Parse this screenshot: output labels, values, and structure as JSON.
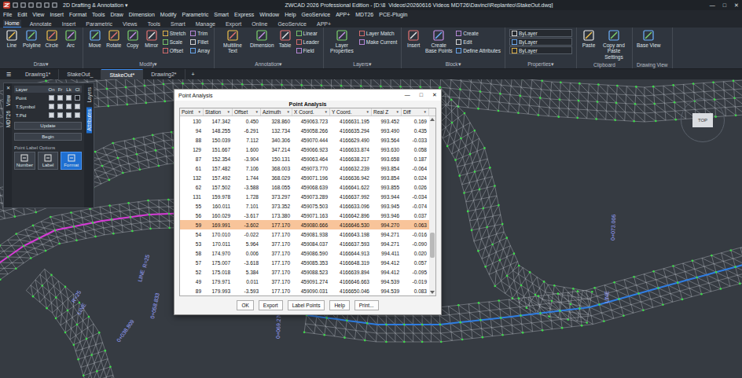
{
  "titlebar": {
    "workspace": "2D Drafting & Annotation",
    "workspace_arrow": "▾",
    "title": "ZWCAD 2026 Professional Edition - [D:\\8_Videos\\20260616 Videos MDT26\\Davinci\\Replanteo\\StakeOut.dwg]",
    "controls": [
      "—",
      "□",
      "✕"
    ]
  },
  "menu": [
    "File",
    "Edit",
    "View",
    "Insert",
    "Format",
    "Tools",
    "Draw",
    "Dimension",
    "Modify",
    "Parametric",
    "Smart",
    "Express",
    "Window",
    "Help",
    "GeoService",
    "APP+",
    "MDT26",
    "PCE-Plugin"
  ],
  "ribbon_tabs": [
    {
      "label": "Home",
      "selected": true
    },
    {
      "label": "Annotate",
      "selected": false
    },
    {
      "label": "Insert",
      "selected": false
    },
    {
      "label": "Parametric",
      "selected": false
    },
    {
      "label": "Views",
      "selected": false
    },
    {
      "label": "Tools",
      "selected": false
    },
    {
      "label": "Smart",
      "selected": false
    },
    {
      "label": "Manage",
      "selected": false
    },
    {
      "label": "Export",
      "selected": false
    },
    {
      "label": "Online",
      "selected": false
    },
    {
      "label": "GeoService",
      "selected": false
    },
    {
      "label": "APP+",
      "selected": false
    }
  ],
  "group_arrow": "▾",
  "ribbon_groups": [
    {
      "label": "Draw",
      "has_menu": true,
      "large": [
        "Line",
        "Polyline",
        "Circle",
        "Arc"
      ],
      "small": []
    },
    {
      "label": "Modify",
      "has_menu": true,
      "large": [
        "Move",
        "Rotate",
        "Copy",
        "Mirror"
      ],
      "small": [
        "Stretch",
        "Scale",
        "Offset",
        "Trim",
        "Fillet",
        "Array"
      ]
    },
    {
      "label": "Annotation",
      "has_menu": true,
      "large": [
        "Multiline Text",
        "Dimension",
        "Table"
      ],
      "small": [
        "Linear",
        "Leader",
        "Field"
      ]
    },
    {
      "label": "Layers",
      "has_menu": true,
      "large": [
        "Layer Properties"
      ],
      "small": [
        "Layer Match",
        "Make Current"
      ]
    },
    {
      "label": "Block",
      "has_menu": true,
      "large": [
        "Insert",
        "Create Base Points"
      ],
      "small": [
        "Create",
        "Edit",
        "Define Attributes"
      ]
    },
    {
      "label": "Properties",
      "has_menu": true,
      "large": [],
      "small": [
        "ByLayer",
        "ByLayer",
        "ByLayer"
      ]
    },
    {
      "label": "Clipboard",
      "has_menu": false,
      "large": [
        "Paste",
        "Copy and Paste Settings"
      ],
      "small": []
    },
    {
      "label": "Drawing View",
      "has_menu": false,
      "large": [
        "Base View"
      ],
      "small": []
    }
  ],
  "doc_menu": "☰",
  "doc_tabs": [
    {
      "label": "Drawing1*",
      "selected": false
    },
    {
      "label": "StakeOut_",
      "selected": false
    },
    {
      "label": "StakeOut*",
      "selected": true
    },
    {
      "label": "Drawing2*",
      "selected": false
    }
  ],
  "doc_add": "+",
  "palette": {
    "close": "✕",
    "left_tabs": [
      "View",
      "MDT26"
    ],
    "header": "Layer",
    "columns": [
      "On",
      "Fr",
      "Lk",
      "Cl"
    ],
    "rows": [
      {
        "label": "Point",
        "checks": [
          true,
          true,
          true,
          false
        ]
      },
      {
        "label": "T.Symbol",
        "checks": [
          true,
          true,
          true,
          true
        ]
      },
      {
        "label": "T.Pid",
        "checks": [
          true,
          true,
          true,
          true
        ]
      }
    ],
    "buttons": [
      "Update",
      "Begin"
    ],
    "section": "Point Label Options",
    "modes": [
      {
        "label": "Number",
        "selected": false
      },
      {
        "label": "Label",
        "selected": false
      },
      {
        "label": "Format",
        "selected": true
      }
    ],
    "side_tabs": [
      {
        "label": "Layers",
        "selected": false
      },
      {
        "label": "Attributes",
        "selected": true
      }
    ]
  },
  "viewcube": {
    "label": "TOP"
  },
  "canvas_labels": [
    "R=25",
    "LINE",
    "0+058.833",
    "0+069.270",
    "R=25",
    "LINE",
    "0+038.809",
    "0+073.006",
    "LINE"
  ],
  "dialog": {
    "title": "Point Analysis",
    "heading": "Point Analysis",
    "controls": [
      "—",
      "□",
      "✕"
    ],
    "filter_icon": "▼",
    "columns": [
      "Point",
      "Station",
      "Offset",
      "Azimuth",
      "X Coord.",
      "Y Coord.",
      "Real Z",
      "Diff"
    ],
    "rows": [
      {
        "cells": [
          "130",
          "147.342",
          "0.450",
          "328.860",
          "459063.723",
          "4166631.195",
          "993.452",
          "0.169"
        ],
        "selected": false
      },
      {
        "cells": [
          "94",
          "148.255",
          "-6.291",
          "132.734",
          "459058.266",
          "4166635.294",
          "993.490",
          "0.435"
        ],
        "selected": false
      },
      {
        "cells": [
          "88",
          "150.039",
          "7.112",
          "340.306",
          "459070.444",
          "4166629.490",
          "993.564",
          "-0.033"
        ],
        "selected": false
      },
      {
        "cells": [
          "129",
          "151.667",
          "1.600",
          "347.214",
          "459066.923",
          "4166633.874",
          "993.630",
          "0.058"
        ],
        "selected": false
      },
      {
        "cells": [
          "87",
          "152.354",
          "-3.904",
          "150.131",
          "459063.464",
          "4166638.217",
          "993.658",
          "0.187"
        ],
        "selected": false
      },
      {
        "cells": [
          "61",
          "157.482",
          "7.106",
          "368.003",
          "459073.770",
          "4166632.239",
          "993.854",
          "-0.064"
        ],
        "selected": false
      },
      {
        "cells": [
          "132",
          "157.492",
          "1.744",
          "368.029",
          "459071.196",
          "4166636.942",
          "993.854",
          "0.024"
        ],
        "selected": false
      },
      {
        "cells": [
          "62",
          "157.502",
          "-3.588",
          "168.055",
          "459068.639",
          "4166641.622",
          "993.855",
          "0.026"
        ],
        "selected": false
      },
      {
        "cells": [
          "131",
          "159.978",
          "1.728",
          "373.297",
          "459073.289",
          "4166637.992",
          "993.944",
          "-0.034"
        ],
        "selected": false
      },
      {
        "cells": [
          "55",
          "160.011",
          "7.101",
          "373.352",
          "459075.503",
          "4166633.096",
          "993.945",
          "-0.074"
        ],
        "selected": false
      },
      {
        "cells": [
          "56",
          "160.029",
          "-3.617",
          "173.380",
          "459071.163",
          "4166642.896",
          "993.946",
          "0.037"
        ],
        "selected": false
      },
      {
        "cells": [
          "59",
          "169.991",
          "-3.602",
          "177.170",
          "459080.666",
          "4166646.530",
          "994.270",
          "0.063"
        ],
        "selected": true
      },
      {
        "cells": [
          "54",
          "170.010",
          "-0.022",
          "177.170",
          "459081.938",
          "4166643.198",
          "994.271",
          "-0.016"
        ],
        "selected": false
      },
      {
        "cells": [
          "53",
          "170.011",
          "5.964",
          "377.170",
          "459084.037",
          "4166637.593",
          "994.271",
          "-0.090"
        ],
        "selected": false
      },
      {
        "cells": [
          "58",
          "174.970",
          "0.006",
          "377.170",
          "459086.590",
          "4166644.913",
          "994.411",
          "0.020"
        ],
        "selected": false
      },
      {
        "cells": [
          "57",
          "175.007",
          "-3.618",
          "177.170",
          "459085.353",
          "4166648.319",
          "994.412",
          "0.057"
        ],
        "selected": false
      },
      {
        "cells": [
          "52",
          "175.018",
          "5.384",
          "377.170",
          "459088.523",
          "4166639.894",
          "994.412",
          "-0.095"
        ],
        "selected": false
      },
      {
        "cells": [
          "49",
          "179.971",
          "0.011",
          "377.170",
          "459091.274",
          "4166646.663",
          "994.539",
          "-0.019"
        ],
        "selected": false
      },
      {
        "cells": [
          "89",
          "179.993",
          "-3.593",
          "177.170",
          "459090.031",
          "4166650.046",
          "994.539",
          "0.083"
        ],
        "selected": false
      }
    ],
    "buttons": [
      "OK",
      "Export",
      "Label Points",
      "Help",
      "Print..."
    ]
  }
}
